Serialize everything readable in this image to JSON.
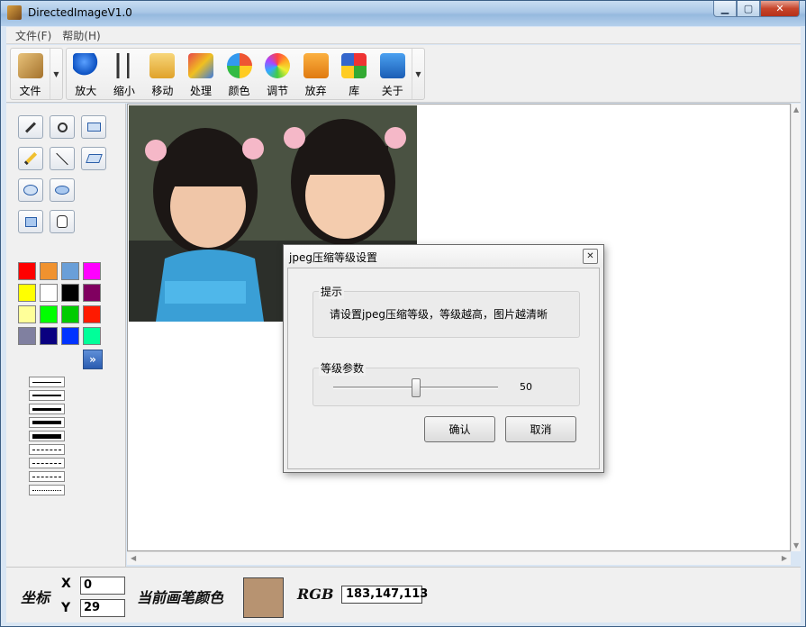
{
  "window": {
    "title": "DirectedImageV1.0"
  },
  "menu": {
    "items": [
      "文件(F)",
      "帮助(H)"
    ]
  },
  "toolbar": {
    "file_label": "文件",
    "buttons": [
      {
        "label": "放大",
        "icon": "magnifier-icon"
      },
      {
        "label": "缩小",
        "icon": "scissors-icon"
      },
      {
        "label": "移动",
        "icon": "folder-move-icon"
      },
      {
        "label": "处理",
        "icon": "process-icon"
      },
      {
        "label": "颜色",
        "icon": "color-ball-icon"
      },
      {
        "label": "调节",
        "icon": "adjust-icon"
      },
      {
        "label": "放弃",
        "icon": "discard-icon"
      },
      {
        "label": "库",
        "icon": "library-icon"
      },
      {
        "label": "关于",
        "icon": "about-icon"
      }
    ]
  },
  "palette": {
    "colors": [
      "#ff0000",
      "#f0922f",
      "#6a9fd8",
      "#ff00ff",
      "#ffff00",
      "#ffffff",
      "#000000",
      "#800060",
      "#ffff99",
      "#00ff00",
      "#00cc00",
      "#ff1a00",
      "#8080a0",
      "#0a0080",
      "#0033ff",
      "#00ff99"
    ]
  },
  "status": {
    "coord_label": "坐标",
    "x_label": "X",
    "y_label": "Y",
    "x_value": "0",
    "y_value": "29",
    "pen_color_label": "当前画笔颜色",
    "rgb_label": "RGB",
    "rgb_value": "183,147,113",
    "pen_color": "#b79371"
  },
  "dialog": {
    "title": "jpeg压缩等级设置",
    "hint_label": "提示",
    "hint_text": "请设置jpeg压缩等级，等级越高，图片越清晰",
    "level_label": "等级参数",
    "level_value": "50",
    "ok_label": "确认",
    "cancel_label": "取消"
  }
}
